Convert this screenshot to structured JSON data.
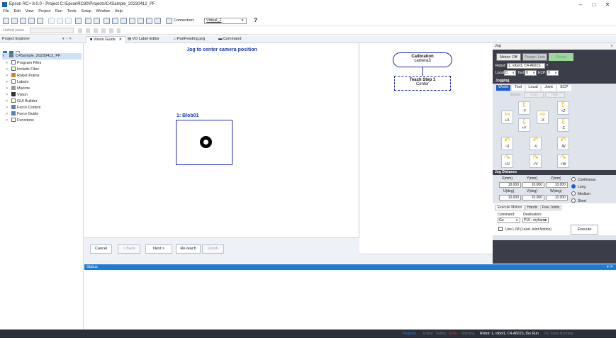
{
  "window": {
    "title": "Epson RC+ 8.0.0 - Project C:\\EpsonRC80\\Projects\\C4Sample_20230412_PF",
    "minimize": "–",
    "maximize": "□",
    "close": "✕"
  },
  "menu": [
    "File",
    "Edit",
    "View",
    "Project",
    "Run",
    "Tools",
    "Setup",
    "Window",
    "Help"
  ],
  "toolbar": {
    "connection_label": "Connection:",
    "connection_value": "Virtual_1",
    "help": "?"
  },
  "tasks_bar": {
    "label": "Halted tasks"
  },
  "tabs": [
    {
      "label": "Vision Guide",
      "close": "✕"
    },
    {
      "label": "I/O Label Editor"
    },
    {
      "label": "PartFeeding.prg"
    },
    {
      "label": "Command"
    }
  ],
  "explorer": {
    "title": "Project Explorer",
    "pin": "▾ ↑ ✕",
    "root": "C4Sample_20230412_PF",
    "items": [
      "Program Files",
      "Include Files",
      "Robot Points",
      "Labels",
      "Macros",
      "Vision",
      "GUI Builder",
      "Force Control",
      "Force Guide",
      "Functions"
    ]
  },
  "wizard": {
    "title": "Jog to center camera position",
    "blob_label": "1: Blob01",
    "buttons": {
      "cancel": "Cancel",
      "back": "< Back",
      "next": "Next >",
      "reteach": "Re-teach",
      "finish": "Finish"
    }
  },
  "flow": {
    "calibration_title": "Calibration",
    "calibration_camera": "camera3",
    "step_title": "Teach Step 1",
    "step_sub": "Center"
  },
  "jog": {
    "title": "Jog",
    "collapse": "∨",
    "motor": "Motor: Off",
    "power": "Power: Low",
    "reset": "Reset",
    "robot_label": "Robot:",
    "robot_value": "1, robot1, C4-A601S",
    "local_label": "Local:",
    "local_value": "0",
    "tool_label": "Tool:",
    "tool_value": "0",
    "ecp_label": "ECP:",
    "ecp_value": "0",
    "jogging": "Jogging",
    "modes": [
      "World",
      "Tool",
      "Local",
      "Joint",
      "ECP"
    ],
    "speed_label": "Speed:",
    "speed_low": "Low",
    "speed_high": "High",
    "arrows": [
      "-Y",
      "+Z",
      "+X",
      "-X",
      "+Y",
      "-Z",
      "-U",
      "-V",
      "-W",
      "+U",
      "+V",
      "+W"
    ],
    "distance_title": "Jog Distance",
    "dist_headers": [
      "X(mm)",
      "Y(mm)",
      "Z(mm)",
      "U(deg)",
      "V(deg)",
      "W(deg)"
    ],
    "dist_values": [
      "10.000",
      "10.000",
      "10.000",
      "10.000",
      "10.000",
      "10.000"
    ],
    "dist_modes": [
      "Continuous",
      "Long",
      "Medium",
      "Short"
    ],
    "dist_selected": "Long",
    "exec_tabs": [
      "Execute Motion",
      "Hands",
      "Free Joints"
    ],
    "command_label": "Command:",
    "command_value": "Go",
    "destination_label": "Destination:",
    "destination_value": "P10 : myhome",
    "lim_label": "Use LJM (Least Joint Motion)",
    "execute": "Execute"
  },
  "status": {
    "title": "Status",
    "pin": "▾ ✕"
  },
  "statusbar": {
    "program": "Program",
    "estop": "EStop",
    "safety": "Safety",
    "error": "Error",
    "warning": "Warning",
    "robot": "Robot: 1, robot1, C4-A601S, Dry Run",
    "tasks": "No Tasks Running"
  },
  "colors": {
    "accent": "#1c7cd5",
    "link_blue": "#1b3aa8",
    "dark_panel": "#3b3e48",
    "status_program": "#2a7be0",
    "status_error": "#d23b3b"
  }
}
